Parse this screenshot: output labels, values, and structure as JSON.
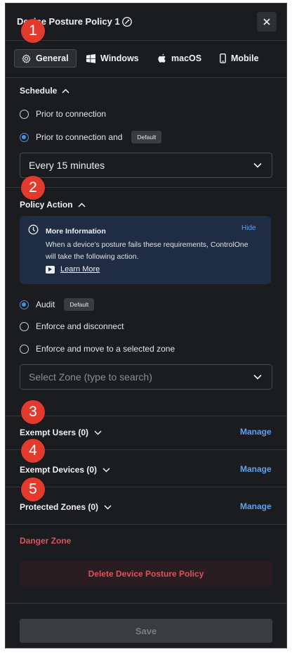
{
  "header": {
    "title": "Device Posture Policy 1"
  },
  "tabs": [
    {
      "label": "General",
      "icon": "gear-icon",
      "active": true
    },
    {
      "label": "Windows",
      "icon": "windows-icon"
    },
    {
      "label": "macOS",
      "icon": "apple-icon"
    },
    {
      "label": "Mobile",
      "icon": "mobile-icon"
    }
  ],
  "schedule": {
    "title": "Schedule",
    "option_1": "Prior to connection",
    "option_2": "Prior to connection and",
    "option_2_badge": "Default",
    "interval": "Every 15 minutes"
  },
  "policy_action": {
    "title": "Policy Action",
    "info_title": "More Information",
    "info_hide": "Hide",
    "info_text": "When a device's posture fails these requirements, ControlOne will take the following action.",
    "learn_more": "Learn More",
    "option_audit": "Audit",
    "option_audit_badge": "Default",
    "option_enforce": "Enforce and disconnect",
    "option_move": "Enforce and move to a selected zone",
    "zone_placeholder": "Select Zone (type to search)"
  },
  "exempt_users": {
    "label": "Exempt Users (0)",
    "action": "Manage"
  },
  "exempt_devices": {
    "label": "Exempt Devices (0)",
    "action": "Manage"
  },
  "protected_zones": {
    "label": "Protected Zones (0)",
    "action": "Manage"
  },
  "danger": {
    "title": "Danger Zone",
    "delete_label": "Delete Device Posture Policy"
  },
  "footer": {
    "save_label": "Save"
  },
  "markers": [
    "1",
    "2",
    "3",
    "4",
    "5"
  ],
  "colors": {
    "accent": "#4a8fe7",
    "danger": "#e0525c",
    "marker": "#e23b2e",
    "background": "#1b1c1f"
  }
}
